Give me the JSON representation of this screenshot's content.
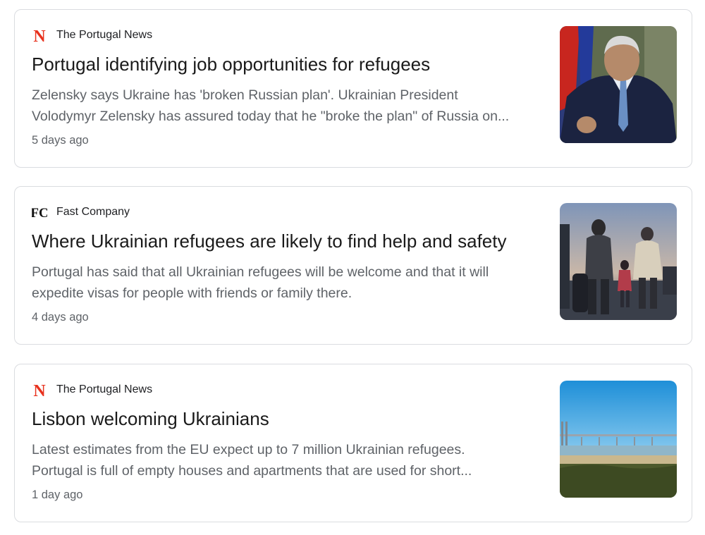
{
  "articles": [
    {
      "source": "The Portugal News",
      "source_icon": "the-portugal-news-logo-icon",
      "title": "Portugal identifying job opportunities for refugees",
      "snippet_line1": "Zelensky says Ukraine has 'broken Russian plan'. Ukrainian President",
      "snippet_line2": "Volodymyr Zelensky has assured today that he \"broke the plan\" of Russia on...",
      "date": "5 days ago",
      "thumbnail": "politician-speaking-photo"
    },
    {
      "source": "Fast Company",
      "source_icon": "fast-company-logo-icon",
      "title": "Where Ukrainian refugees are likely to find help and safety",
      "snippet_line1": "Portugal has said that all Ukrainian refugees will be welcome and that it will",
      "snippet_line2": "expedite visas for people with friends or family there.",
      "date": "4 days ago",
      "thumbnail": "refugees-walking-photo"
    },
    {
      "source": "The Portugal News",
      "source_icon": "the-portugal-news-logo-icon",
      "title": "Lisbon welcoming Ukrainians",
      "snippet_line1": "Latest estimates from the EU expect up to 7 million Ukrainian refugees.",
      "snippet_line2": "Portugal is full of empty houses and apartments that are used for short...",
      "date": "1 day ago",
      "thumbnail": "lisbon-bridge-photo"
    }
  ],
  "logos": {
    "portugal_news_letter": "N",
    "fast_company_letters": "FC"
  },
  "colors": {
    "portugal_news_red": "#e8321e",
    "border": "#dadce0",
    "snippet_gray": "#5f6368"
  }
}
